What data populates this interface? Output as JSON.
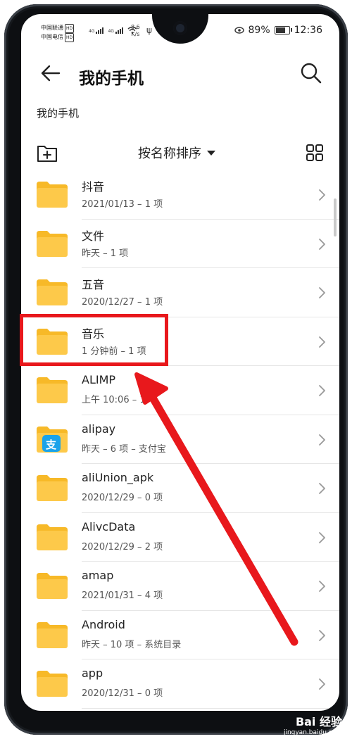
{
  "status": {
    "carrier1": "中国联通",
    "carrier2": "中国电信",
    "hd": "HD",
    "net1": "4G",
    "net2": "4G",
    "speed_value": "8.6",
    "speed_unit": "K/s",
    "battery": "89%",
    "time": "12:36"
  },
  "header": {
    "title": "我的手机"
  },
  "breadcrumb": "我的手机",
  "toolbar": {
    "sort_label": "按名称排序"
  },
  "items": [
    {
      "name": "抖音",
      "meta": "2021/01/13 – 1 项",
      "icon": "folder-icon"
    },
    {
      "name": "文件",
      "meta": "昨天 – 1 项",
      "icon": "folder-icon"
    },
    {
      "name": "五音",
      "meta": "2020/12/27 – 1 项",
      "icon": "folder-icon"
    },
    {
      "name": "音乐",
      "meta": "1 分钟前 – 1 项",
      "icon": "folder-icon"
    },
    {
      "name": "ALIMP",
      "meta": "上午 10:06 – 1 项",
      "icon": "folder-icon"
    },
    {
      "name": "alipay",
      "meta": "昨天 – 6 项 – 支付宝",
      "icon": "alipay-icon",
      "badge": "支"
    },
    {
      "name": "aliUnion_apk",
      "meta": "2020/12/29 – 0 项",
      "icon": "folder-icon"
    },
    {
      "name": "AlivcData",
      "meta": "2020/12/29 – 2 项",
      "icon": "folder-icon"
    },
    {
      "name": "amap",
      "meta": "2021/01/31 – 4 项",
      "icon": "folder-icon"
    },
    {
      "name": "Android",
      "meta": "昨天 – 10 项 – 系统目录",
      "icon": "folder-icon"
    },
    {
      "name": "app",
      "meta": "2020/12/31 – 0 项",
      "icon": "folder-icon"
    }
  ],
  "colors": {
    "folder": "#fdc94a",
    "folder_tab": "#f7b928",
    "highlight": "#e8181c",
    "alipay": "#1aa3ea"
  },
  "watermark": {
    "line1": "Bai 经验",
    "line2": "jingyan.baidu.com"
  }
}
